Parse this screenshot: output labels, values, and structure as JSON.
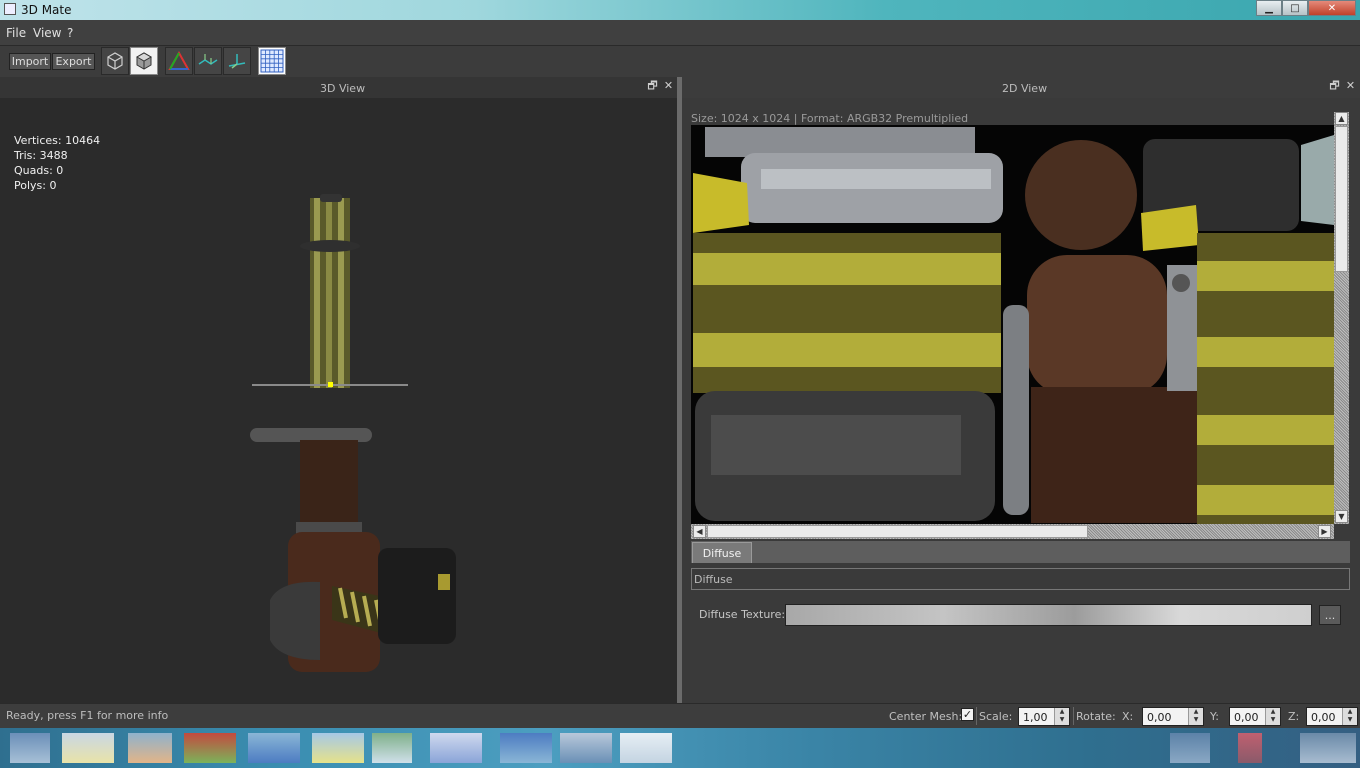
{
  "window": {
    "title": "3D Mate",
    "minimize": "▁",
    "maximize": "□",
    "close": "✕"
  },
  "menu": {
    "items": [
      "File",
      "View",
      "?"
    ]
  },
  "toolbar": {
    "import_label": "Import",
    "export_label": "Export"
  },
  "view3d": {
    "title": "3D View",
    "stats": [
      "Vertices: 10464",
      "Tris: 3488",
      "Quads: 0",
      "Polys: 0"
    ]
  },
  "view2d": {
    "title": "2D View",
    "size_info": "Size: 1024 x 1024 | Format: ARGB32 Premultiplied",
    "tab": "Diffuse",
    "group_title": "Diffuse",
    "texture_label": "Diffuse Texture:",
    "browse_label": "..."
  },
  "dock": {
    "float_icon": "🗗",
    "close_icon": "✕"
  },
  "status": {
    "text": "Ready, press F1 for more info",
    "center_mesh_label": "Center Mesh:",
    "center_mesh_checked": "✓",
    "scale_label": "Scale:",
    "scale_value": "1,00",
    "rotate_label": "Rotate:",
    "x_label": "X:",
    "x_value": "0,00",
    "y_label": "Y:",
    "y_value": "0,00",
    "z_label": "Z:",
    "z_value": "0,00"
  },
  "colors": {
    "accent_titlebar": "#3aa6ae",
    "panel_bg": "#2b2b2b",
    "texture_yellow": "#a8a040"
  }
}
